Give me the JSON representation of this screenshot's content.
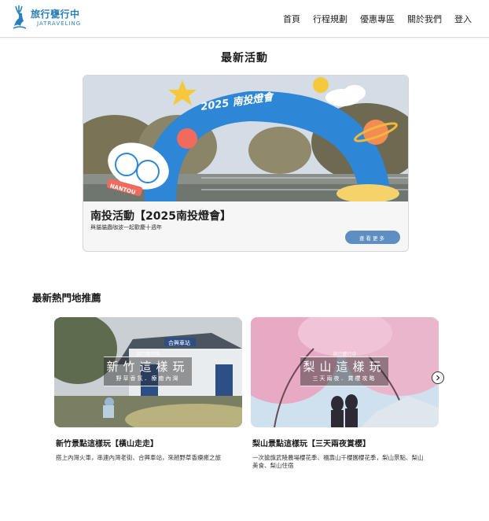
{
  "header": {
    "logo": {
      "cn": "旅行甕行中",
      "en": "JATRAVELING"
    },
    "nav": [
      "首頁",
      "行程規劃",
      "優惠專區",
      "關於我們",
      "登入"
    ]
  },
  "latest": {
    "title": "最新活動",
    "card": {
      "image_text": "2025 南投燈會",
      "image_badge": "NANTOU",
      "title": "南投活動【2025南投燈會】",
      "desc": "與貓貓蟲咖波一起歡慶十週年",
      "button": "查看更多"
    }
  },
  "hot": {
    "title": "最新熱門地推薦",
    "cards": [
      {
        "overlay_brand": "旅行甕行中",
        "overlay_title": "新竹這樣玩",
        "overlay_sub": "野草香氛．療癒內灣",
        "station_sign": "合興車站",
        "name": "新竹景點這樣玩【橫山走走】",
        "desc": "搭上內灣火車，串連內灣老街、合興車站，來趟野草香療癒之旅"
      },
      {
        "overlay_brand": "旅行甕行中",
        "overlay_title": "梨山這樣玩",
        "overlay_sub": "三天兩夜．賞櫻攻略",
        "name": "梨山景點這樣玩【三天兩夜賞櫻】",
        "desc": "一次搶旗武陵農場櫻花季、福壽山千櫻園櫻花季，梨山景點、梨山美食、梨山住宿"
      }
    ]
  },
  "colors": {
    "accent": "#2a7fb8",
    "button": "#5f8fc2"
  },
  "icons": {
    "next": "chevron-right-icon",
    "logo": "deer-logo-icon"
  }
}
